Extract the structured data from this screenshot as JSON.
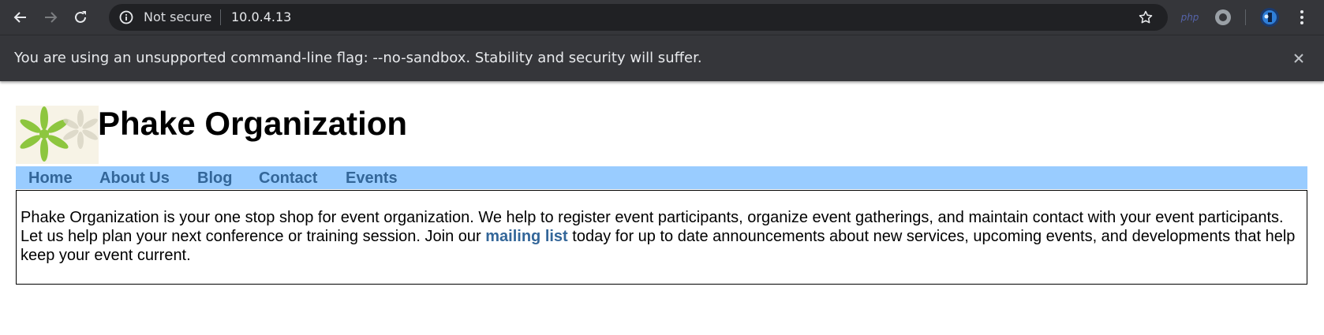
{
  "browser": {
    "security_status": "Not secure",
    "url": "10.0.4.13",
    "icons": [
      "back-arrow-icon",
      "forward-arrow-icon",
      "reload-icon",
      "info-icon",
      "star-icon",
      "php-extension-icon",
      "record-extension-icon",
      "profile-avatar-icon",
      "more-menu-icon"
    ],
    "extension_php_label": "php"
  },
  "infobar": {
    "message": "You are using an unsupported command-line flag: --no-sandbox. Stability and security will suffer."
  },
  "site": {
    "title": "Phake Organization",
    "nav": [
      {
        "label": "Home"
      },
      {
        "label": "About Us"
      },
      {
        "label": "Blog"
      },
      {
        "label": "Contact"
      },
      {
        "label": "Events"
      }
    ],
    "content": {
      "intro": "Phake Organization is your one stop shop for event organization. We help to register event participants, organize event gatherings, and maintain contact with your event participants. Let us help plan your next conference or training session. Join our ",
      "link": "mailing list",
      "outro": " today for up to date announcements about new services, upcoming events, and developments that help keep your event current."
    },
    "colors": {
      "nav_background": "#99ccff",
      "link": "#336699",
      "logo_leaf": "#8dc63f"
    }
  }
}
